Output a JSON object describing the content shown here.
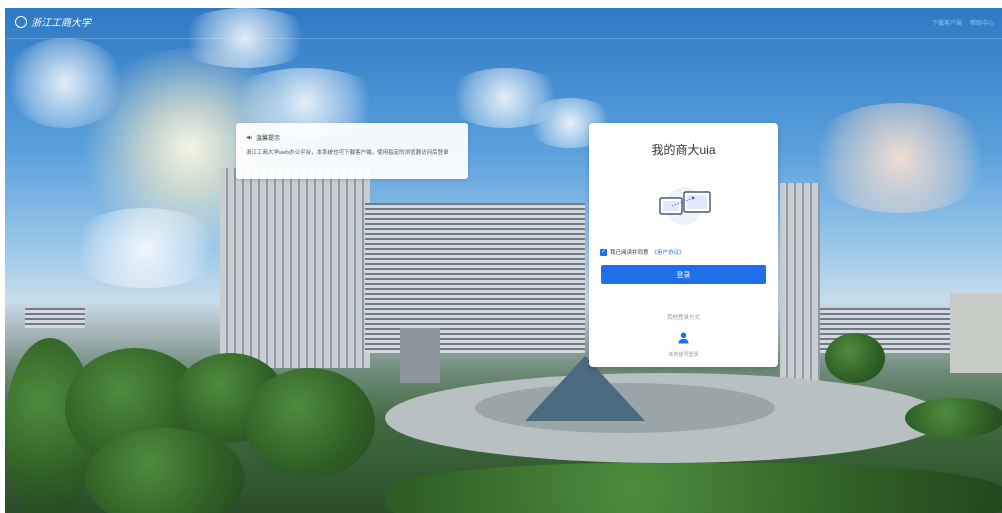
{
  "header": {
    "logo_text": "浙江工商大学",
    "links": [
      "下载客户端",
      "帮助中心"
    ]
  },
  "notice": {
    "title": "温馨提示",
    "body": "浙江工商大学web办公平台，本系统也可下载客户端，使用指定的浏览器访问后登录"
  },
  "login": {
    "title": "我的商大uia",
    "agree_text": "我已阅读并同意",
    "agree_link": "《用户协议》",
    "agree_checked": true,
    "login_button": "登录",
    "other_title": "其他登录方式",
    "other_method_label": "本地账号登录"
  },
  "colors": {
    "accent": "#1e6fe8",
    "link": "#8fc3ff"
  }
}
